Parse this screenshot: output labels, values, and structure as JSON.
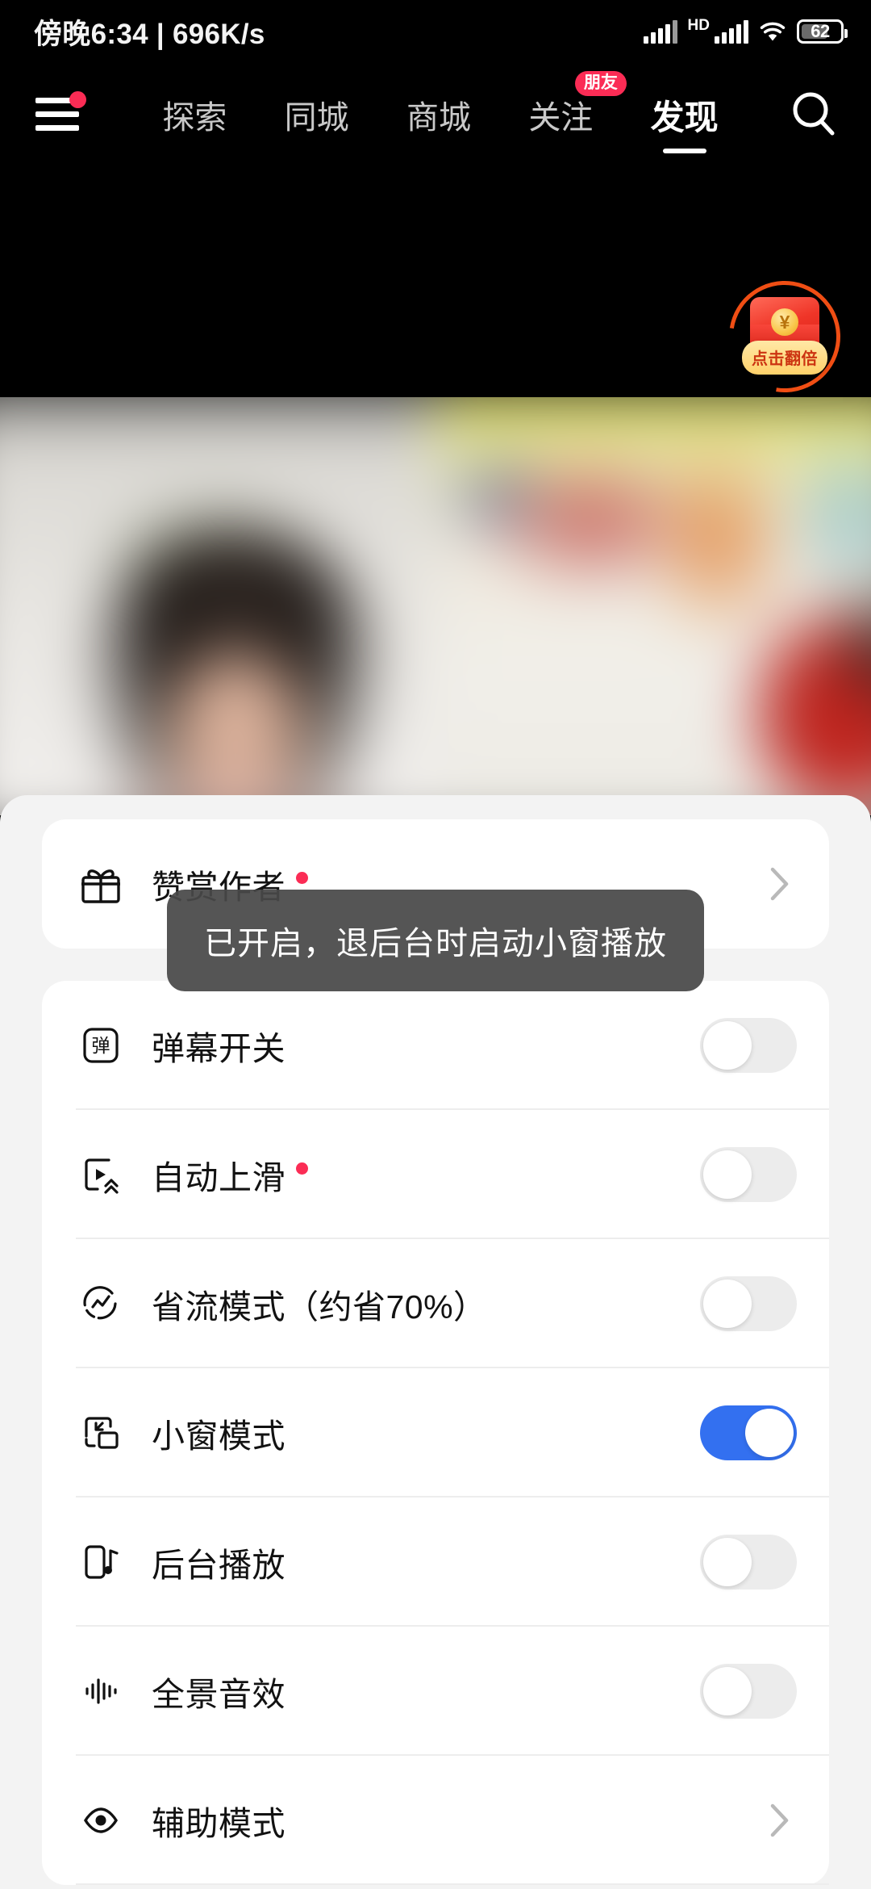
{
  "status_bar": {
    "time_text": "傍晚6:34",
    "separator": "|",
    "network_speed": "696K/s",
    "hd_label": "HD",
    "battery_level": "62",
    "icons": [
      "signal-bars-icon",
      "hd-icon",
      "signal-bars-icon",
      "wifi-icon",
      "battery-icon"
    ]
  },
  "nav": {
    "menu_icon": "hamburger-menu-icon",
    "search_icon": "search-icon",
    "tabs": [
      {
        "label": "探索",
        "active": false,
        "badge": null
      },
      {
        "label": "同城",
        "active": false,
        "badge": null
      },
      {
        "label": "商城",
        "active": false,
        "badge": null
      },
      {
        "label": "关注",
        "active": false,
        "badge": "朋友"
      },
      {
        "label": "发现",
        "active": true,
        "badge": null
      }
    ]
  },
  "floating_promo": {
    "icon": "red-packet-icon",
    "currency_symbol": "¥",
    "button_label": "点击翻倍"
  },
  "toast": {
    "message": "已开启，退后台时启动小窗播放"
  },
  "sheet": {
    "donate_card": {
      "icon": "gift-icon",
      "label": "赞赏作者",
      "has_red_dot": true,
      "accessory": "chevron-right-icon"
    },
    "settings_card": {
      "rows": [
        {
          "icon": "danmaku-icon",
          "label": "弹幕开关",
          "has_red_dot": false,
          "accessory": "toggle",
          "state": "off"
        },
        {
          "icon": "auto-scroll-icon",
          "label": "自动上滑",
          "has_red_dot": true,
          "accessory": "toggle",
          "state": "off"
        },
        {
          "icon": "data-saver-icon",
          "label": "省流模式（约省70%）",
          "has_red_dot": false,
          "accessory": "toggle",
          "state": "off"
        },
        {
          "icon": "pip-window-icon",
          "label": "小窗模式",
          "has_red_dot": false,
          "accessory": "toggle",
          "state": "on"
        },
        {
          "icon": "background-play-icon",
          "label": "后台播放",
          "has_red_dot": false,
          "accessory": "toggle",
          "state": "off"
        },
        {
          "icon": "surround-audio-icon",
          "label": "全景音效",
          "has_red_dot": false,
          "accessory": "toggle",
          "state": "off"
        },
        {
          "icon": "eye-icon",
          "label": "辅助模式",
          "has_red_dot": false,
          "accessory": "chevron-right-icon",
          "state": null
        }
      ]
    }
  },
  "colors": {
    "accent_red": "#fb2c55",
    "toggle_on_blue": "#3370f0",
    "toggle_off_gray": "#ececec",
    "sheet_background": "#f3f3f3",
    "card_background": "#ffffff",
    "promo_orange": "#f04e14",
    "toast_background": "#484848"
  }
}
